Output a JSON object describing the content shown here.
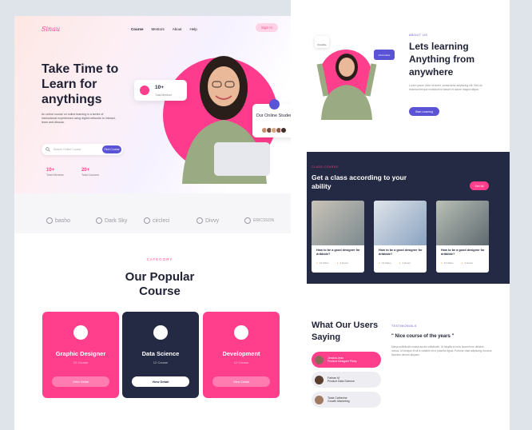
{
  "left_page": {
    "logo": "Sinau",
    "nav": [
      "Course",
      "Mentors",
      "About",
      "Help"
    ],
    "signin": "Sign In",
    "hero_title": "Take Time to Learn for anythings",
    "hero_desc": "An online course on online learning is a series of instructional experiences using digital networks to interact, learn and discuss.",
    "search_placeholder": "Search Online Course",
    "find_button": "Find Course",
    "stats": [
      {
        "num": "10+",
        "label": "Total Mentors"
      },
      {
        "num": "20+",
        "label": "Total Courses"
      }
    ],
    "mentors_badge": {
      "num": "10+",
      "label": "Total Mentors"
    },
    "student_badge": "Our Online Student",
    "brands": [
      "basho",
      "Dark Sky",
      "circleci",
      "Divvy",
      "ERICSSON"
    ],
    "category_label": "CATEGORY",
    "category_title": "Our Popular Course",
    "cards": [
      {
        "title": "Graphic Designer",
        "count": "12 Course",
        "button": "View Detail",
        "theme": "pink"
      },
      {
        "title": "Data Science",
        "count": "12 Course",
        "button": "View Detail",
        "theme": "dark"
      },
      {
        "title": "Development",
        "count": "12 Course",
        "button": "View Detail",
        "theme": "pink"
      }
    ]
  },
  "right_page": {
    "pill_left": "Possible",
    "pill_right": "Informative",
    "about_label": "ABOUT US",
    "about_title": "Lets learning Anything from anywhere",
    "about_text": "Lorem ipsum dolor sit amet, consectetur adipiscing elit. Sed do eiusmod tempor incididunt ut labore et dolore magna aliqua.",
    "start_button": "Start Learning",
    "class_label": "CLASS COURSE",
    "class_title": "Get a class according to your ability",
    "see_all": "See All",
    "class_cards": [
      {
        "title": "How to be a good designer for dribbble?",
        "lessons": "12 Video",
        "hours": "4 Hours"
      },
      {
        "title": "How to be a good designer for dribbble?",
        "lessons": "12 Video",
        "hours": "4 Hours"
      },
      {
        "title": "How to be a good designer for dribbble?",
        "lessons": "12 Video",
        "hours": "4 Hours"
      }
    ],
    "testimonial_title": "What Our Users Saying",
    "testimonials": [
      {
        "name": "Jessica Jean",
        "role": "Product Designer Pinky"
      },
      {
        "name": "Farhan M",
        "role": "Product Data Science"
      },
      {
        "name": "Tania Catherine",
        "role": "Growth Marketing"
      }
    ],
    "testimonial_label": "TESTIMONIALS",
    "quote": "\" Nice course of the years \"",
    "quote_body": "Marya sollicitudin massa auctor sollicitudin. Ut fringilla id ecos laoreet non ultricies cursus. Ut tamque id sit is variable sit ut pharetra ligula. Pulvinar vitae adipiscing rhoncus faucibus ultrices aliquam."
  },
  "colors": {
    "pink": "#ff3f8b",
    "purple": "#5b53d6",
    "dark": "#242a43"
  }
}
